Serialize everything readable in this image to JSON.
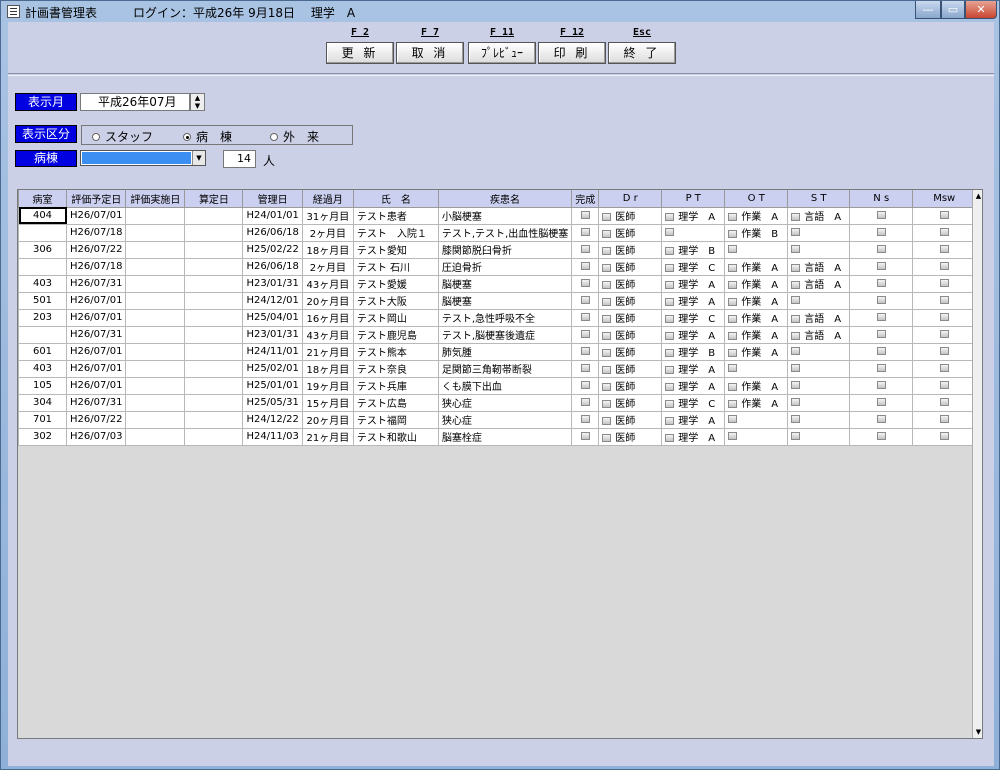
{
  "window": {
    "title": "計画書管理表",
    "login_info": "ログイン：平成26年 9月18日　 理学　A",
    "min": "—",
    "max": "▭",
    "close": "✕"
  },
  "fkeys": [
    {
      "key": "F 2",
      "label": "更 新"
    },
    {
      "key": "F 7",
      "label": "取 消"
    },
    {
      "key": "F 11",
      "label": "ﾌﾟﾚﾋﾞｭｰ"
    },
    {
      "key": "F 12",
      "label": "印 刷"
    },
    {
      "key": "Esc",
      "label": "終 了"
    }
  ],
  "filters": {
    "month_label": "表示月",
    "month_value": "平成26年07月",
    "category_label": "表示区分",
    "radio_options": [
      "スタッフ",
      "病　棟",
      "外　来"
    ],
    "radio_selected": 1,
    "ward_label": "病棟",
    "ward_value": "",
    "count_value": "14",
    "count_unit": "人"
  },
  "table": {
    "headers": [
      "病室",
      "評価予定日",
      "評価実施日",
      "算定日",
      "管理日",
      "経過月",
      "氏　名",
      "疾患名",
      "完成",
      "D r",
      "P T",
      "O T",
      "S T",
      "N s",
      "Msw"
    ],
    "rows": [
      [
        "404",
        "H26/07/01",
        "",
        "",
        "H24/01/01",
        "31ヶ月目",
        "テスト患者",
        "小脳梗塞",
        "",
        "医師",
        "理学　A",
        "作業　A",
        "言語　A",
        "",
        ""
      ],
      [
        "",
        "H26/07/18",
        "",
        "",
        "H26/06/18",
        "2ヶ月目",
        "テスト　入院１",
        "テスト,テスト,出血性脳梗塞",
        "",
        "医師",
        "",
        "作業　B",
        "",
        "",
        ""
      ],
      [
        "306",
        "H26/07/22",
        "",
        "",
        "H25/02/22",
        "18ヶ月目",
        "テスト愛知",
        "膝関節脱臼骨折",
        "",
        "医師",
        "理学　B",
        "",
        "",
        "",
        ""
      ],
      [
        "",
        "H26/07/18",
        "",
        "",
        "H26/06/18",
        "2ヶ月目",
        "テスト 石川",
        "圧迫骨折",
        "",
        "医師",
        "理学　C",
        "作業　A",
        "言語　A",
        "",
        ""
      ],
      [
        "403",
        "H26/07/31",
        "",
        "",
        "H23/01/31",
        "43ヶ月目",
        "テスト愛媛",
        "脳梗塞",
        "",
        "医師",
        "理学　A",
        "作業　A",
        "言語　A",
        "",
        ""
      ],
      [
        "501",
        "H26/07/01",
        "",
        "",
        "H24/12/01",
        "20ヶ月目",
        "テスト大阪",
        "脳梗塞",
        "",
        "医師",
        "理学　A",
        "作業　A",
        "",
        "",
        ""
      ],
      [
        "203",
        "H26/07/01",
        "",
        "",
        "H25/04/01",
        "16ヶ月目",
        "テスト岡山",
        "テスト,急性呼吸不全",
        "",
        "医師",
        "理学　C",
        "作業　A",
        "言語　A",
        "",
        ""
      ],
      [
        "",
        "H26/07/31",
        "",
        "",
        "H23/01/31",
        "43ヶ月目",
        "テスト鹿児島",
        "テスト,脳梗塞後遺症",
        "",
        "医師",
        "理学　A",
        "作業　A",
        "言語　A",
        "",
        ""
      ],
      [
        "601",
        "H26/07/01",
        "",
        "",
        "H24/11/01",
        "21ヶ月目",
        "テスト熊本",
        "肺気腫",
        "",
        "医師",
        "理学　B",
        "作業　A",
        "",
        "",
        ""
      ],
      [
        "403",
        "H26/07/01",
        "",
        "",
        "H25/02/01",
        "18ヶ月目",
        "テスト奈良",
        "足関節三角靭帯断裂",
        "",
        "医師",
        "理学　A",
        "",
        "",
        "",
        ""
      ],
      [
        "105",
        "H26/07/01",
        "",
        "",
        "H25/01/01",
        "19ヶ月目",
        "テスト兵庫",
        "くも膜下出血",
        "",
        "医師",
        "理学　A",
        "作業　A",
        "",
        "",
        ""
      ],
      [
        "304",
        "H26/07/31",
        "",
        "",
        "H25/05/31",
        "15ヶ月目",
        "テスト広島",
        "狭心症",
        "",
        "医師",
        "理学　C",
        "作業　A",
        "",
        "",
        ""
      ],
      [
        "701",
        "H26/07/22",
        "",
        "",
        "H24/12/22",
        "20ヶ月目",
        "テスト福岡",
        "狭心症",
        "",
        "医師",
        "理学　A",
        "",
        "",
        "",
        ""
      ],
      [
        "302",
        "H26/07/03",
        "",
        "",
        "H24/11/03",
        "21ヶ月目",
        "テスト和歌山",
        "脳塞栓症",
        "",
        "医師",
        "理学　A",
        "",
        "",
        "",
        ""
      ]
    ]
  }
}
